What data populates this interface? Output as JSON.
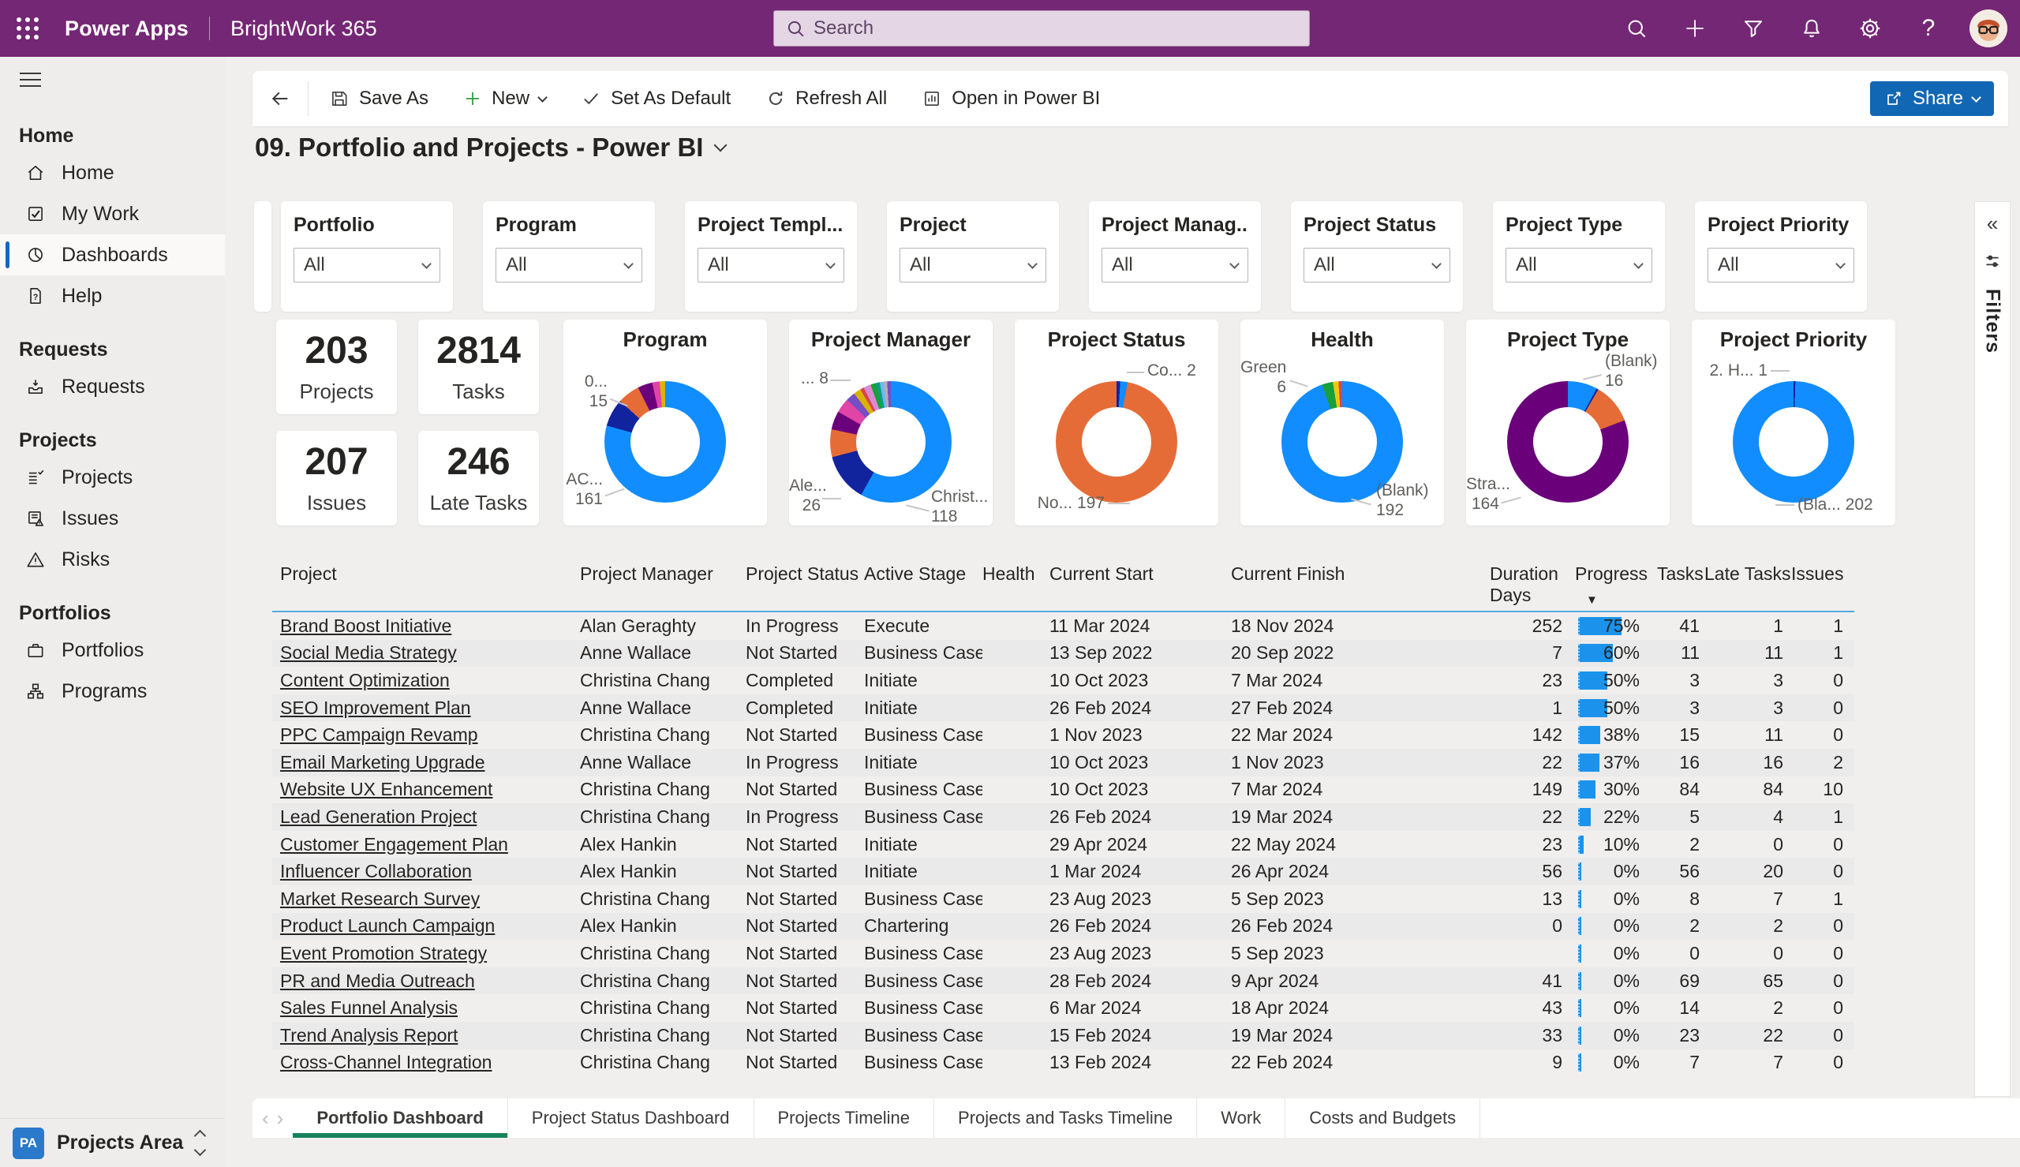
{
  "topbar": {
    "app_name": "Power Apps",
    "environment": "BrightWork 365",
    "search_placeholder": "Search"
  },
  "toolbar": {
    "save_as": "Save As",
    "new": "New",
    "set_default": "Set As Default",
    "refresh": "Refresh All",
    "open_bi": "Open in Power BI",
    "share": "Share"
  },
  "page": {
    "title": "09. Portfolio and Projects - Power BI"
  },
  "sidebar": {
    "sections": [
      {
        "label": "Home",
        "items": [
          {
            "label": "Home"
          },
          {
            "label": "My Work"
          },
          {
            "label": "Dashboards",
            "selected": true
          },
          {
            "label": "Help"
          }
        ]
      },
      {
        "label": "Requests",
        "items": [
          {
            "label": "Requests"
          }
        ]
      },
      {
        "label": "Projects",
        "items": [
          {
            "label": "Projects"
          },
          {
            "label": "Issues"
          },
          {
            "label": "Risks"
          }
        ]
      },
      {
        "label": "Portfolios",
        "items": [
          {
            "label": "Portfolios"
          },
          {
            "label": "Programs"
          }
        ]
      }
    ],
    "area": {
      "badge": "PA",
      "label": "Projects Area"
    }
  },
  "filters": {
    "rail_label": "Filters",
    "cards": [
      {
        "label": "Portfolio",
        "value": "All"
      },
      {
        "label": "Program",
        "value": "All"
      },
      {
        "label": "Project Templ...",
        "value": "All"
      },
      {
        "label": "Project",
        "value": "All"
      },
      {
        "label": "Project Manag...",
        "value": "All"
      },
      {
        "label": "Project Status",
        "value": "All"
      },
      {
        "label": "Project Type",
        "value": "All"
      },
      {
        "label": "Project Priority",
        "value": "All"
      }
    ]
  },
  "kpis": [
    {
      "value": "203",
      "label": "Projects"
    },
    {
      "value": "2814",
      "label": "Tasks"
    },
    {
      "value": "207",
      "label": "Issues"
    },
    {
      "value": "246",
      "label": "Late Tasks"
    }
  ],
  "chart_data": [
    {
      "type": "pie",
      "title": "Program",
      "total": 203,
      "slices": [
        {
          "label": "AC...",
          "value": 161,
          "color": "#118DFF"
        },
        {
          "label": "0...",
          "value": 15,
          "color": "#12239E"
        },
        {
          "label": "other-orange",
          "value": 12,
          "color": "#E66C37"
        },
        {
          "label": "other-purple",
          "value": 8,
          "color": "#6B007B"
        },
        {
          "label": "other-magenta",
          "value": 4,
          "color": "#E044A7"
        },
        {
          "label": "other-gold",
          "value": 3,
          "color": "#D9B300"
        }
      ],
      "callouts": [
        {
          "line1": "0...",
          "line2": "15"
        },
        {
          "line1": "AC...",
          "line2": "161"
        }
      ]
    },
    {
      "type": "pie",
      "title": "Project Manager",
      "total": 203,
      "slices": [
        {
          "label": "Christ...",
          "value": 118,
          "color": "#118DFF"
        },
        {
          "label": "Ale...",
          "value": 26,
          "color": "#12239E"
        },
        {
          "label": "s3",
          "value": 15,
          "color": "#E66C37"
        },
        {
          "label": "s4",
          "value": 10,
          "color": "#6B007B"
        },
        {
          "label": "s5",
          "value": 8,
          "color": "#E044A7"
        },
        {
          "label": "s6",
          "value": 5,
          "color": "#744EC2"
        },
        {
          "label": "s7",
          "value": 4,
          "color": "#D9B300"
        },
        {
          "label": "s8",
          "value": 2,
          "color": "#D64550"
        },
        {
          "label": "s9",
          "value": 4,
          "color": "#DB8BD6"
        },
        {
          "label": "s10",
          "value": 3,
          "color": "#18A03C"
        },
        {
          "label": "s11",
          "value": 2,
          "color": "#0F9C8C"
        },
        {
          "label": "s12",
          "value": 2,
          "color": "#6CB8F6"
        },
        {
          "label": "s13",
          "value": 2,
          "color": "#B3B0AD"
        },
        {
          "label": "s14",
          "value": 2,
          "color": "#744EC2"
        }
      ],
      "callouts": [
        {
          "line1": "... 8"
        },
        {
          "line1": "Ale...",
          "line2": "26"
        },
        {
          "line1": "Christ...",
          "line2": "118"
        }
      ]
    },
    {
      "type": "pie",
      "title": "Project Status",
      "total": 203,
      "slices": [
        {
          "label": "Co...",
          "value": 2,
          "color": "#12239E"
        },
        {
          "label": "blue",
          "value": 4,
          "color": "#118DFF"
        },
        {
          "label": "No...",
          "value": 197,
          "color": "#E66C37"
        }
      ],
      "callouts": [
        {
          "line1": "Co... 2"
        },
        {
          "line1": "No... 197"
        }
      ]
    },
    {
      "type": "pie",
      "title": "Health",
      "total": 203,
      "slices": [
        {
          "label": "(Blank)",
          "value": 192,
          "color": "#118DFF"
        },
        {
          "label": "Green",
          "value": 6,
          "color": "#18A03C"
        },
        {
          "label": "yellow",
          "value": 3,
          "color": "#F2C80F"
        },
        {
          "label": "red",
          "value": 2,
          "color": "#D64550"
        }
      ],
      "callouts": [
        {
          "line1": "Green",
          "line2": "6"
        },
        {
          "line1": "(Blank)",
          "line2": "192"
        }
      ]
    },
    {
      "type": "pie",
      "title": "Project Type",
      "total": 203,
      "slices": [
        {
          "label": "(Blank)",
          "value": 16,
          "color": "#118DFF"
        },
        {
          "label": "navy",
          "value": 1,
          "color": "#12239E"
        },
        {
          "label": "orange",
          "value": 22,
          "color": "#E66C37"
        },
        {
          "label": "Stra...",
          "value": 164,
          "color": "#6B007B"
        }
      ],
      "callouts": [
        {
          "line1": "(Blank)",
          "line2": "16"
        },
        {
          "line1": "Stra...",
          "line2": "164"
        }
      ]
    },
    {
      "type": "pie",
      "title": "Project Priority",
      "total": 203,
      "slices": [
        {
          "label": "2. H...",
          "value": 1,
          "color": "#12239E"
        },
        {
          "label": "(Bla...",
          "value": 202,
          "color": "#118DFF"
        }
      ],
      "callouts": [
        {
          "line1": "2. H... 1"
        },
        {
          "line1": "(Bla... 202"
        }
      ]
    }
  ],
  "table": {
    "headers": [
      "Project",
      "Project Manager",
      "Project Status",
      "Active Stage",
      "Health",
      "Current Start",
      "Current Finish",
      "Duration",
      "Days",
      "Progress",
      "Tasks",
      "Late Tasks",
      "Issues"
    ],
    "rows": [
      {
        "project": "Brand Boost Initiative",
        "manager": "Alan Geraghty",
        "status": "In Progress",
        "stage": "Execute",
        "health": "",
        "start": "11 Mar 2024",
        "finish": "18 Nov 2024",
        "duration": "252",
        "progress_pct": 75,
        "progress": "75%",
        "tasks": "41",
        "late_tasks": "1",
        "issues": "1"
      },
      {
        "project": "Social Media Strategy",
        "manager": "Anne Wallace",
        "status": "Not Started",
        "stage": "Business Case",
        "health": "",
        "start": "13 Sep 2022",
        "finish": "20 Sep 2022",
        "duration": "7",
        "progress_pct": 60,
        "progress": "60%",
        "tasks": "11",
        "late_tasks": "11",
        "issues": "1"
      },
      {
        "project": "Content Optimization",
        "manager": "Christina Chang",
        "status": "Completed",
        "stage": "Initiate",
        "health": "",
        "start": "10 Oct 2023",
        "finish": "7 Mar 2024",
        "duration": "23",
        "progress_pct": 50,
        "progress": "50%",
        "tasks": "3",
        "late_tasks": "3",
        "issues": "0"
      },
      {
        "project": "SEO Improvement Plan",
        "manager": "Anne Wallace",
        "status": "Completed",
        "stage": "Initiate",
        "health": "",
        "start": "26 Feb 2024",
        "finish": "27 Feb 2024",
        "duration": "1",
        "progress_pct": 50,
        "progress": "50%",
        "tasks": "3",
        "late_tasks": "3",
        "issues": "0"
      },
      {
        "project": "PPC Campaign Revamp",
        "manager": "Christina Chang",
        "status": "Not Started",
        "stage": "Business Case",
        "health": "",
        "start": "1 Nov 2023",
        "finish": "22 Mar 2024",
        "duration": "142",
        "progress_pct": 38,
        "progress": "38%",
        "tasks": "15",
        "late_tasks": "11",
        "issues": "0"
      },
      {
        "project": "Email Marketing Upgrade",
        "manager": "Anne Wallace",
        "status": "In Progress",
        "stage": "Initiate",
        "health": "",
        "start": "10 Oct 2023",
        "finish": "1 Nov 2023",
        "duration": "22",
        "progress_pct": 37,
        "progress": "37%",
        "tasks": "16",
        "late_tasks": "16",
        "issues": "2"
      },
      {
        "project": "Website UX Enhancement",
        "manager": "Christina Chang",
        "status": "Not Started",
        "stage": "Business Case",
        "health": "",
        "start": "10 Oct 2023",
        "finish": "7 Mar 2024",
        "duration": "149",
        "progress_pct": 30,
        "progress": "30%",
        "tasks": "84",
        "late_tasks": "84",
        "issues": "10"
      },
      {
        "project": "Lead Generation Project",
        "manager": "Christina Chang",
        "status": "In Progress",
        "stage": "Business Case",
        "health": "",
        "start": "26 Feb 2024",
        "finish": "19 Mar 2024",
        "duration": "22",
        "progress_pct": 22,
        "progress": "22%",
        "tasks": "5",
        "late_tasks": "4",
        "issues": "1"
      },
      {
        "project": "Customer Engagement Plan",
        "manager": "Alex Hankin",
        "status": "Not Started",
        "stage": "Initiate",
        "health": "",
        "start": "29 Apr 2024",
        "finish": "22 May 2024",
        "duration": "23",
        "progress_pct": 10,
        "progress": "10%",
        "tasks": "2",
        "late_tasks": "0",
        "issues": "0"
      },
      {
        "project": "Influencer Collaboration",
        "manager": "Alex Hankin",
        "status": "Not Started",
        "stage": "Initiate",
        "health": "",
        "start": "1 Mar 2024",
        "finish": "26 Apr 2024",
        "duration": "56",
        "progress_pct": 0,
        "progress": "0%",
        "tasks": "56",
        "late_tasks": "20",
        "issues": "0"
      },
      {
        "project": "Market Research Survey",
        "manager": "Christina Chang",
        "status": "Not Started",
        "stage": "Business Case",
        "health": "",
        "start": "23 Aug 2023",
        "finish": "5 Sep 2023",
        "duration": "13",
        "progress_pct": 0,
        "progress": "0%",
        "tasks": "8",
        "late_tasks": "7",
        "issues": "1"
      },
      {
        "project": "Product Launch Campaign",
        "manager": "Alex Hankin",
        "status": "Not Started",
        "stage": "Chartering",
        "health": "",
        "start": "26 Feb 2024",
        "finish": "26 Feb 2024",
        "duration": "0",
        "progress_pct": 0,
        "progress": "0%",
        "tasks": "2",
        "late_tasks": "2",
        "issues": "0"
      },
      {
        "project": "Event Promotion Strategy",
        "manager": "Christina Chang",
        "status": "Not Started",
        "stage": "Business Case",
        "health": "",
        "start": "23 Aug 2023",
        "finish": "5 Sep 2023",
        "duration": "",
        "progress_pct": 0,
        "progress": "0%",
        "tasks": "0",
        "late_tasks": "0",
        "issues": "0"
      },
      {
        "project": "PR and Media Outreach",
        "manager": "Christina Chang",
        "status": "Not Started",
        "stage": "Business Case",
        "health": "",
        "start": "28 Feb 2024",
        "finish": "9 Apr 2024",
        "duration": "41",
        "progress_pct": 0,
        "progress": "0%",
        "tasks": "69",
        "late_tasks": "65",
        "issues": "0"
      },
      {
        "project": "Sales Funnel Analysis",
        "manager": "Christina Chang",
        "status": "Not Started",
        "stage": "Business Case",
        "health": "",
        "start": "6 Mar 2024",
        "finish": "18 Apr 2024",
        "duration": "43",
        "progress_pct": 0,
        "progress": "0%",
        "tasks": "14",
        "late_tasks": "2",
        "issues": "0"
      },
      {
        "project": "Trend Analysis Report",
        "manager": "Christina Chang",
        "status": "Not Started",
        "stage": "Business Case",
        "health": "",
        "start": "15 Feb 2024",
        "finish": "19 Mar 2024",
        "duration": "33",
        "progress_pct": 0,
        "progress": "0%",
        "tasks": "23",
        "late_tasks": "22",
        "issues": "0"
      },
      {
        "project": "Cross-Channel Integration",
        "manager": "Christina Chang",
        "status": "Not Started",
        "stage": "Business Case",
        "health": "",
        "start": "13 Feb 2024",
        "finish": "22 Feb 2024",
        "duration": "9",
        "progress_pct": 0,
        "progress": "0%",
        "tasks": "7",
        "late_tasks": "7",
        "issues": "0"
      }
    ]
  },
  "tabs": {
    "items": [
      {
        "label": "Portfolio Dashboard",
        "selected": true
      },
      {
        "label": "Project Status Dashboard"
      },
      {
        "label": "Projects Timeline"
      },
      {
        "label": "Projects and Tasks Timeline"
      },
      {
        "label": "Work"
      },
      {
        "label": "Costs and Budgets"
      }
    ]
  }
}
